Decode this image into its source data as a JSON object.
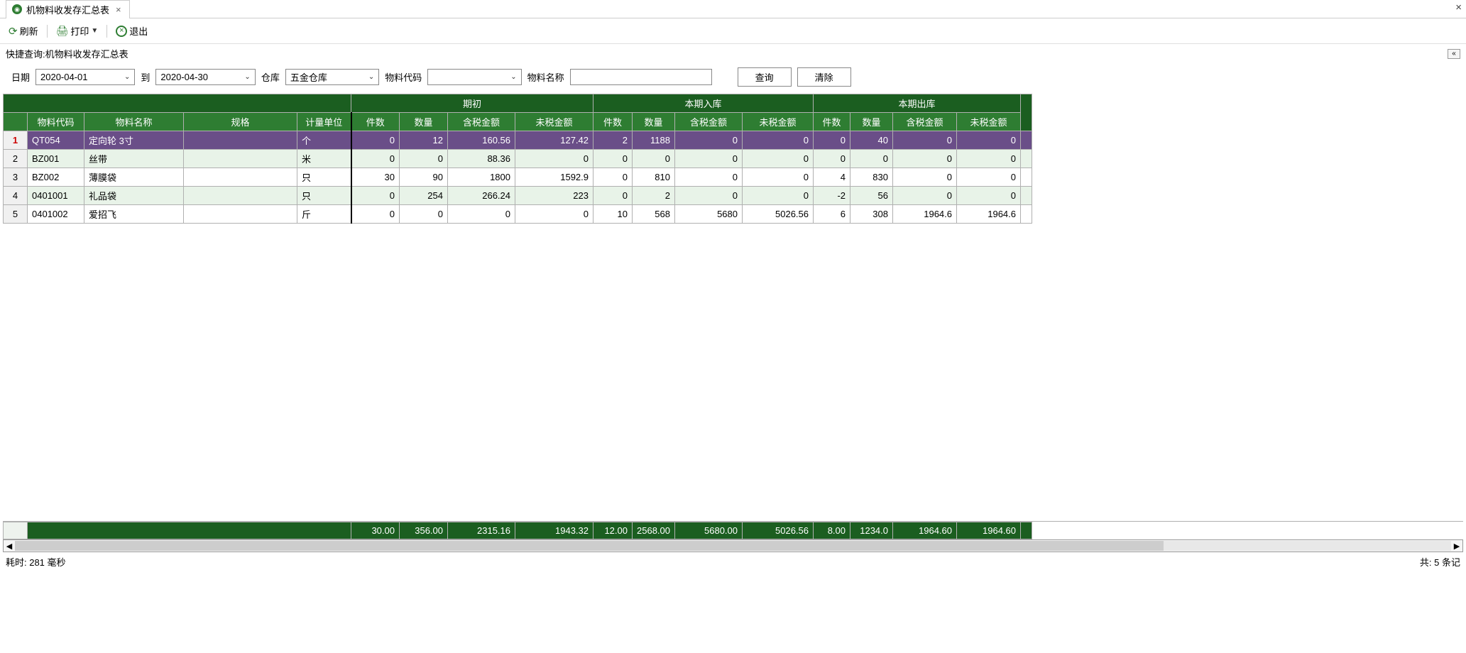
{
  "tab": {
    "title": "机物料收发存汇总表"
  },
  "toolbar": {
    "refresh": "刷新",
    "print": "打印",
    "exit": "退出"
  },
  "query": {
    "header": "快捷查询:机物料收发存汇总表",
    "date_label": "日期",
    "date_from": "2020-04-01",
    "date_to_label": "到",
    "date_to": "2020-04-30",
    "warehouse_label": "仓库",
    "warehouse_value": "五金仓库",
    "matcode_label": "物料代码",
    "matcode_value": "",
    "matname_label": "物料名称",
    "matname_value": "",
    "search_btn": "查询",
    "clear_btn": "清除"
  },
  "headers": {
    "group_opening": "期初",
    "group_in": "本期入库",
    "group_out": "本期出库",
    "matcode": "物料代码",
    "matname": "物料名称",
    "spec": "规格",
    "unit": "计量单位",
    "pieces": "件数",
    "qty": "数量",
    "amt_tax": "含税金额",
    "amt_notax": "未税金额"
  },
  "rows": [
    {
      "n": "1",
      "code": "QT054",
      "name": "定向轮 3寸",
      "spec": "",
      "unit": "个",
      "op_p": "0",
      "op_q": "12",
      "op_t": "160.56",
      "op_n": "127.42",
      "in_p": "2",
      "in_q": "1188",
      "in_t": "0",
      "in_n": "0",
      "out_p": "0",
      "out_q": "40",
      "out_t": "0",
      "out_n": "0",
      "sel": true
    },
    {
      "n": "2",
      "code": "BZ001",
      "name": "丝带",
      "spec": "",
      "unit": "米",
      "op_p": "0",
      "op_q": "0",
      "op_t": "88.36",
      "op_n": "0",
      "in_p": "0",
      "in_q": "0",
      "in_t": "0",
      "in_n": "0",
      "out_p": "0",
      "out_q": "0",
      "out_t": "0",
      "out_n": "0"
    },
    {
      "n": "3",
      "code": "BZ002",
      "name": "薄膜袋",
      "spec": "",
      "unit": "只",
      "op_p": "30",
      "op_q": "90",
      "op_t": "1800",
      "op_n": "1592.9",
      "in_p": "0",
      "in_q": "810",
      "in_t": "0",
      "in_n": "0",
      "out_p": "4",
      "out_q": "830",
      "out_t": "0",
      "out_n": "0"
    },
    {
      "n": "4",
      "code": "0401001",
      "name": "礼品袋",
      "spec": "",
      "unit": "只",
      "op_p": "0",
      "op_q": "254",
      "op_t": "266.24",
      "op_n": "223",
      "in_p": "0",
      "in_q": "2",
      "in_t": "0",
      "in_n": "0",
      "out_p": "-2",
      "out_q": "56",
      "out_t": "0",
      "out_n": "0"
    },
    {
      "n": "5",
      "code": "0401002",
      "name": "爱招飞",
      "spec": "",
      "unit": "斤",
      "op_p": "0",
      "op_q": "0",
      "op_t": "0",
      "op_n": "0",
      "in_p": "10",
      "in_q": "568",
      "in_t": "5680",
      "in_n": "5026.56",
      "out_p": "6",
      "out_q": "308",
      "out_t": "1964.6",
      "out_n": "1964.6"
    }
  ],
  "totals": {
    "op_p": "30.00",
    "op_q": "356.00",
    "op_t": "2315.16",
    "op_n": "1943.32",
    "in_p": "12.00",
    "in_q": "2568.00",
    "in_t": "5680.00",
    "in_n": "5026.56",
    "out_p": "8.00",
    "out_q": "1234.0",
    "out_t": "1964.60",
    "out_n": "1964.60"
  },
  "status": {
    "time": "耗时: 281 毫秒",
    "count": "共: 5 条记"
  }
}
